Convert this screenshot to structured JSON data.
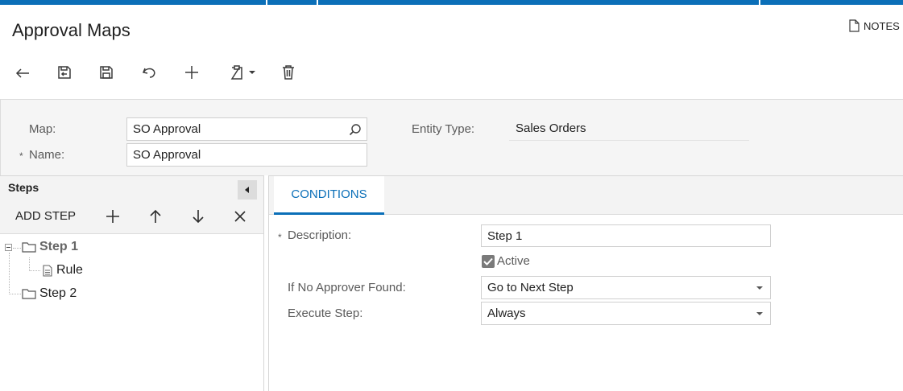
{
  "header": {
    "title": "Approval Maps",
    "notes_label": "NOTES"
  },
  "toolbar": {
    "buttons": [
      {
        "icon": "back-arrow-icon"
      },
      {
        "icon": "save-close-icon"
      },
      {
        "icon": "save-icon"
      },
      {
        "icon": "undo-icon"
      },
      {
        "icon": "add-icon"
      },
      {
        "icon": "copy-paste-icon"
      },
      {
        "icon": "delete-icon"
      }
    ]
  },
  "form": {
    "map_label": "Map:",
    "map_value": "SO Approval",
    "name_required_mark": "*",
    "name_label": "Name:",
    "name_value": "SO Approval",
    "entity_type_label": "Entity Type:",
    "entity_type_value": "Sales Orders"
  },
  "steps_panel": {
    "title": "Steps",
    "add_step_label": "ADD STEP",
    "tree": {
      "step1": "Step 1",
      "rule": "Rule",
      "step2": "Step 2"
    }
  },
  "details": {
    "tab_label": "CONDITIONS",
    "description_required_mark": "*",
    "description_label": "Description:",
    "description_value": "Step 1",
    "active_label": "Active",
    "active_checked": true,
    "no_approver_label": "If No Approver Found:",
    "no_approver_value": "Go to Next Step",
    "execute_step_label": "Execute Step:",
    "execute_step_value": "Always"
  },
  "colors": {
    "accent": "#0b6fb8",
    "panel_bg": "#f3f3f3",
    "form_bg": "#f5f5f5"
  }
}
